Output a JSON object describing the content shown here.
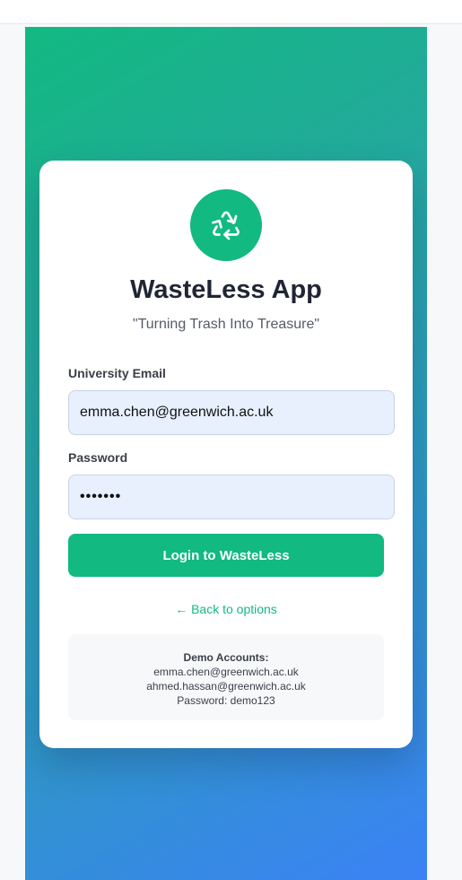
{
  "app": {
    "title": "WasteLess App",
    "tagline": "\"Turning Trash Into Treasure\"",
    "logo_icon": "recycle-icon",
    "brand_color": "#12b981",
    "gradient_colors": [
      "#12b981",
      "#3b82f6"
    ]
  },
  "form": {
    "email_label": "University Email",
    "email_value": "emma.chen@greenwich.ac.uk",
    "password_label": "Password",
    "password_masked": "•••••••",
    "submit_label": "Login to WasteLess"
  },
  "nav": {
    "back_label": "← Back to options"
  },
  "demo": {
    "heading": "Demo Accounts:",
    "accounts": [
      "emma.chen@greenwich.ac.uk",
      "ahmed.hassan@greenwich.ac.uk"
    ],
    "password_line": "Password: demo123"
  }
}
